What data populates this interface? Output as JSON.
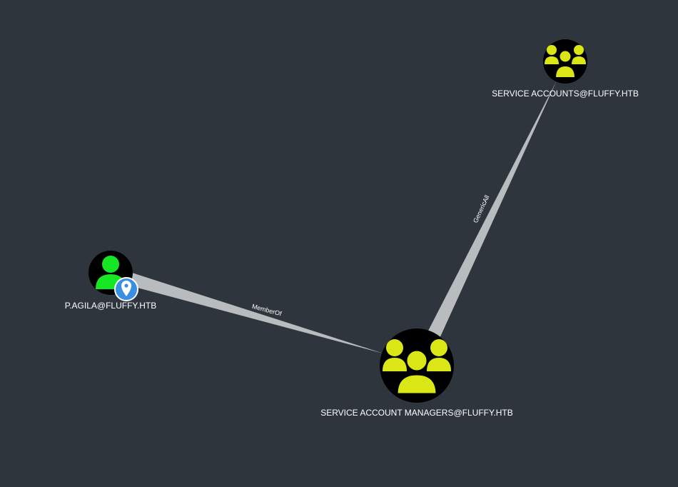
{
  "graph": {
    "background": "#2e353d",
    "nodes": {
      "user": {
        "label": "P.AGILA@FLUFFY.HTB",
        "type": "user",
        "icon": "user-icon",
        "badge": "location-pin-icon",
        "icon_color": "#17e625",
        "badge_color": "#3a8fe0"
      },
      "managers": {
        "label": "SERVICE ACCOUNT MANAGERS@FLUFFY.HTB",
        "type": "group",
        "icon": "group-icon",
        "icon_color": "#dbe617"
      },
      "accounts": {
        "label": "SERVICE ACCOUNTS@FLUFFY.HTB",
        "type": "group",
        "icon": "group-icon",
        "icon_color": "#dbe617"
      }
    },
    "edges": {
      "member_of": {
        "label": "MemberOf",
        "source": "P.AGILA@FLUFFY.HTB",
        "target": "SERVICE ACCOUNT MANAGERS@FLUFFY.HTB"
      },
      "generic_all": {
        "label": "GenericAll",
        "source": "SERVICE ACCOUNT MANAGERS@FLUFFY.HTB",
        "target": "SERVICE ACCOUNTS@FLUFFY.HTB"
      }
    },
    "edge_color": "#b9bcbf",
    "node_fill": "#000000"
  }
}
